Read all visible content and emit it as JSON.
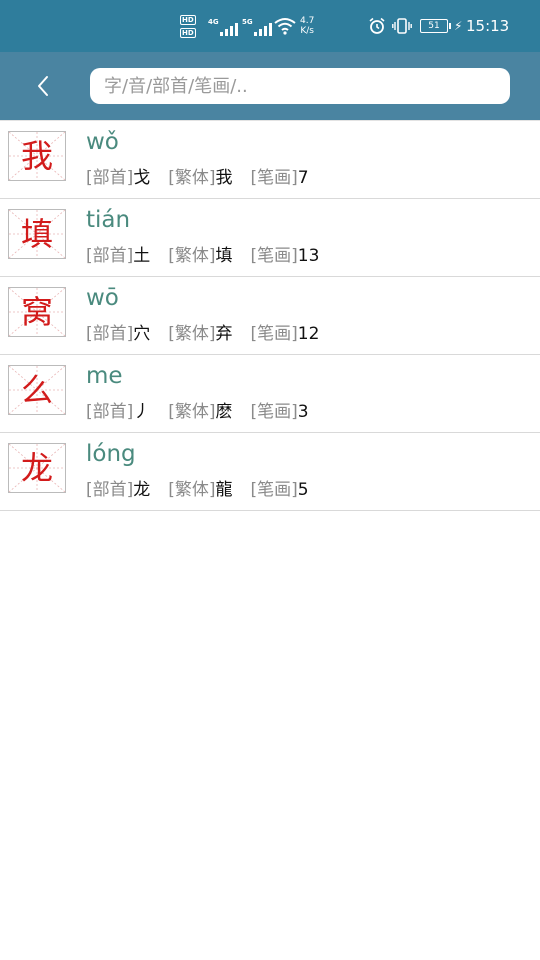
{
  "status_bar": {
    "hd_badge": "HD",
    "net1": "4G",
    "net2": "5G",
    "speed_value": "4.7",
    "speed_unit": "K/s",
    "battery": "51",
    "time": "15:13"
  },
  "header": {
    "search_placeholder": "字/音/部首/笔画/.."
  },
  "labels": {
    "radical": "[部首]",
    "traditional": "[繁体]",
    "strokes": "[笔画]"
  },
  "results": [
    {
      "char": "我",
      "pinyin": "wǒ",
      "radical": "戈",
      "traditional": "我",
      "strokes": "7"
    },
    {
      "char": "填",
      "pinyin": "tián",
      "radical": "土",
      "traditional": "填",
      "strokes": "13"
    },
    {
      "char": "窝",
      "pinyin": "wō",
      "radical": "穴",
      "traditional": "弃",
      "strokes": "12"
    },
    {
      "char": "么",
      "pinyin": "me",
      "radical": "丿",
      "traditional": "麽",
      "strokes": "3"
    },
    {
      "char": "龙",
      "pinyin": "lóng",
      "radical": "龙",
      "traditional": "龍",
      "strokes": "5"
    }
  ],
  "colors": {
    "status_bar_bg": "#2f7d9c",
    "header_bg": "#4a84a1",
    "char_red": "#d21b1b",
    "pinyin_green": "#4a8a7e"
  }
}
